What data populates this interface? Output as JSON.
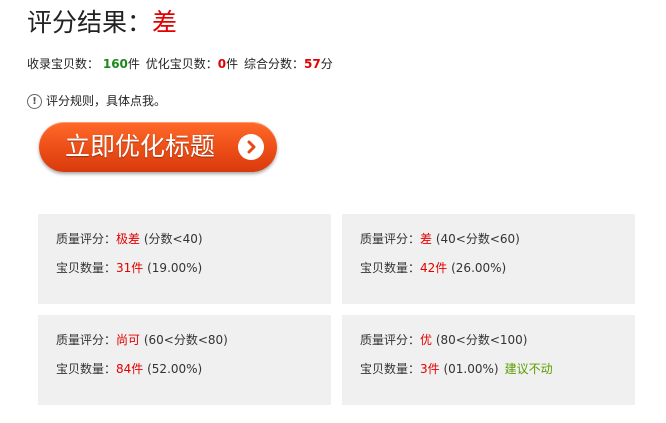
{
  "header": {
    "label": "评分结果：",
    "grade": "差"
  },
  "stats": {
    "collected_label": "收录宝贝数：",
    "collected_value": "160",
    "collected_unit": "件",
    "optimized_label": "优化宝贝数：",
    "optimized_value": "0",
    "optimized_unit": "件",
    "score_label": "综合分数：",
    "score_value": "57",
    "score_unit": "分"
  },
  "rule_link": {
    "icon": "exclamation-icon",
    "label": "评分规则，具体点我。"
  },
  "optimize_button": {
    "label": "立即优化标题",
    "icon": "chevron-right-icon"
  },
  "colors": {
    "accent": "#f0521a",
    "red": "#e30000",
    "green": "#1b8a1b",
    "card_bg": "#f0f0f0"
  },
  "cards": [
    {
      "quality_label": "质量评分：",
      "quality_value": "极差",
      "range": " (分数<40)",
      "count_label": "宝贝数量：",
      "count_value": "31件",
      "percent": " (19.00%)",
      "note": ""
    },
    {
      "quality_label": "质量评分：",
      "quality_value": "差",
      "range": " (40<分数<60)",
      "count_label": "宝贝数量：",
      "count_value": "42件",
      "percent": " (26.00%)",
      "note": ""
    },
    {
      "quality_label": "质量评分：",
      "quality_value": "尚可",
      "range": " (60<分数<80)",
      "count_label": "宝贝数量：",
      "count_value": "84件",
      "percent": " (52.00%)",
      "note": ""
    },
    {
      "quality_label": "质量评分：",
      "quality_value": "优",
      "range": " (80<分数<100)",
      "count_label": "宝贝数量：",
      "count_value": "3件",
      "percent": " (01.00%)",
      "note": "建议不动"
    }
  ]
}
